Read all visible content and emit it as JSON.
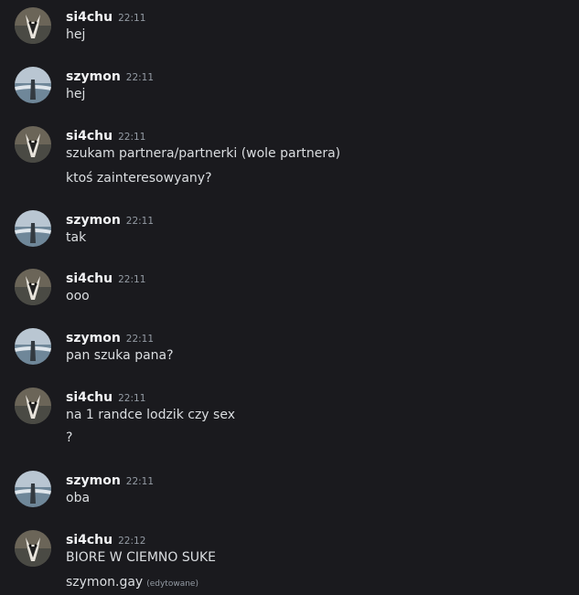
{
  "messages": [
    {
      "author": "si4chu",
      "avatar": "cat-avatar",
      "time": "22:11",
      "lines": [
        "hej"
      ]
    },
    {
      "author": "szymon",
      "avatar": "sea-avatar",
      "time": "22:11",
      "lines": [
        "hej"
      ]
    },
    {
      "author": "si4chu",
      "avatar": "cat-avatar",
      "time": "22:11",
      "lines": [
        "szukam partnera/partnerki (wole partnera)",
        "ktoś zainteresowyany?"
      ]
    },
    {
      "author": "szymon",
      "avatar": "sea-avatar",
      "time": "22:11",
      "lines": [
        "tak"
      ]
    },
    {
      "author": "si4chu",
      "avatar": "cat-avatar",
      "time": "22:11",
      "lines": [
        "ooo"
      ]
    },
    {
      "author": "szymon",
      "avatar": "sea-avatar",
      "time": "22:11",
      "lines": [
        "pan szuka pana?"
      ]
    },
    {
      "author": "si4chu",
      "avatar": "cat-avatar",
      "time": "22:11",
      "lines": [
        "na 1 randce lodzik czy sex",
        "?"
      ]
    },
    {
      "author": "szymon",
      "avatar": "sea-avatar",
      "time": "22:11",
      "lines": [
        "oba"
      ]
    },
    {
      "author": "si4chu",
      "avatar": "cat-avatar",
      "time": "22:12",
      "lines": [
        "BIORE W CIEMNO SUKE",
        "szymon.gay"
      ],
      "edited_label": "(edytowane)"
    }
  ]
}
